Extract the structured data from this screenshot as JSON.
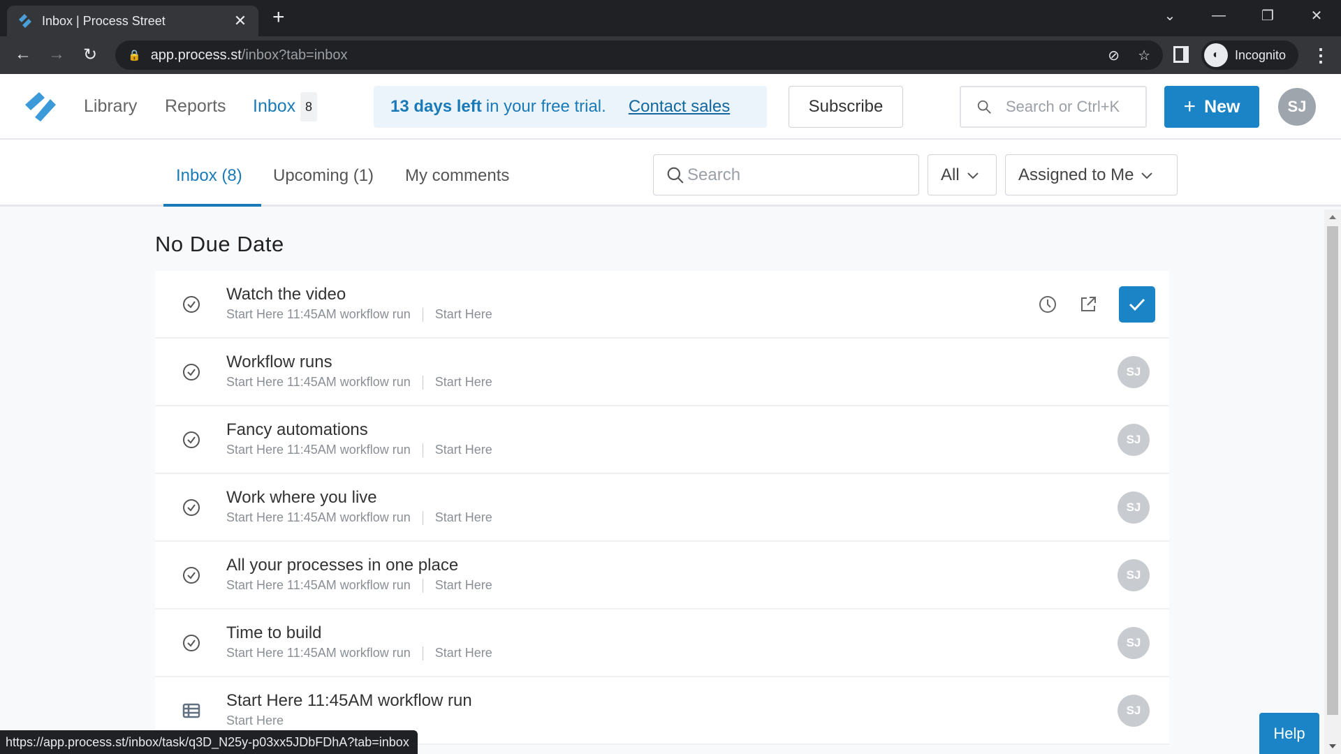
{
  "browser": {
    "tab_title": "Inbox | Process Street",
    "new_tab_label": "+",
    "url_host": "app.process.st",
    "url_path": "/inbox?tab=inbox",
    "profile_label": "Incognito",
    "status_url": "https://app.process.st/inbox/task/q3D_N25y-p03xx5JDbFDhA?tab=inbox"
  },
  "header": {
    "nav": [
      {
        "label": "Library"
      },
      {
        "label": "Reports"
      },
      {
        "label": "Inbox",
        "badge": "8",
        "active": true
      }
    ],
    "trial": {
      "bold": "13 days left",
      "text": "in your free trial.",
      "link": "Contact sales"
    },
    "subscribe_label": "Subscribe",
    "search_placeholder": "Search or Ctrl+K",
    "new_label": "New",
    "user_initials": "SJ",
    "accent_color": "#1a84c7"
  },
  "subnav": {
    "tabs": [
      {
        "label": "Inbox (8)",
        "active": true
      },
      {
        "label": "Upcoming (1)"
      },
      {
        "label": "My comments"
      }
    ],
    "search_placeholder": "Search",
    "filter_type": "All",
    "filter_assignee": "Assigned to Me"
  },
  "section": {
    "title": "No Due Date",
    "items": [
      {
        "type": "task",
        "title": "Watch the video",
        "run": "Start Here 11:45AM workflow run",
        "workflow": "Start Here",
        "hovered": true
      },
      {
        "type": "task",
        "title": "Workflow runs",
        "run": "Start Here 11:45AM workflow run",
        "workflow": "Start Here",
        "assignee": "SJ"
      },
      {
        "type": "task",
        "title": "Fancy automations",
        "run": "Start Here 11:45AM workflow run",
        "workflow": "Start Here",
        "assignee": "SJ"
      },
      {
        "type": "task",
        "title": "Work where you live",
        "run": "Start Here 11:45AM workflow run",
        "workflow": "Start Here",
        "assignee": "SJ"
      },
      {
        "type": "task",
        "title": "All your processes in one place",
        "run": "Start Here 11:45AM workflow run",
        "workflow": "Start Here",
        "assignee": "SJ"
      },
      {
        "type": "task",
        "title": "Time to build",
        "run": "Start Here 11:45AM workflow run",
        "workflow": "Start Here",
        "assignee": "SJ"
      },
      {
        "type": "run",
        "title": "Start Here 11:45AM workflow run",
        "workflow": "Start Here",
        "assignee": "SJ"
      }
    ]
  },
  "help_label": "Help"
}
